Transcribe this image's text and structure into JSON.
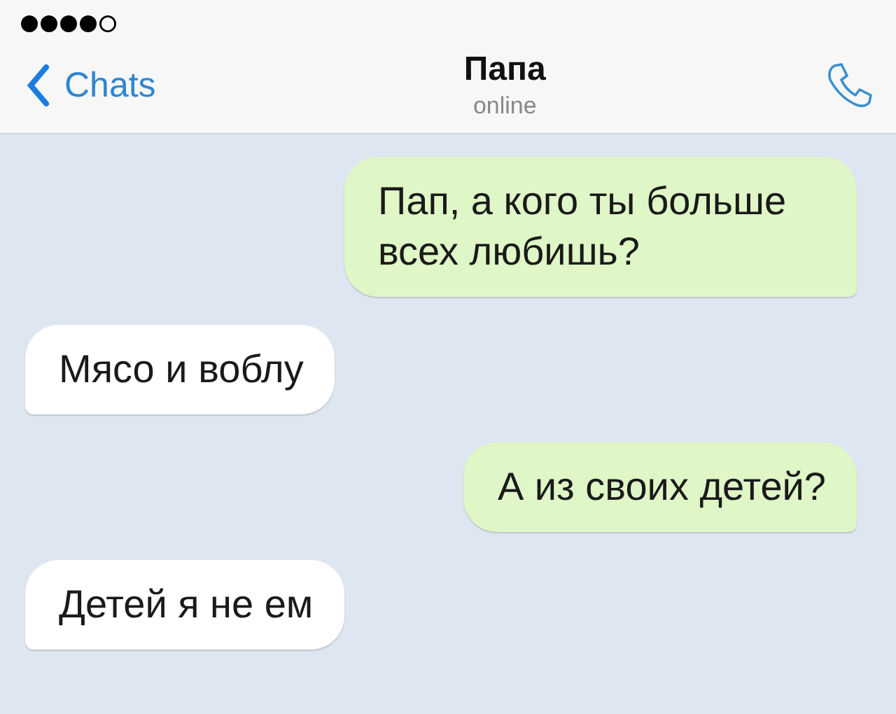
{
  "header": {
    "back_label": "Chats",
    "title": "Папа",
    "status": "online"
  },
  "messages": [
    {
      "text": "Пап, а кого ты больше всех любишь?",
      "outgoing": true
    },
    {
      "text": "Мясо и воблу",
      "outgoing": false
    },
    {
      "text": "А из своих детей?",
      "outgoing": true
    },
    {
      "text": "Детей я не ем",
      "outgoing": false
    }
  ]
}
